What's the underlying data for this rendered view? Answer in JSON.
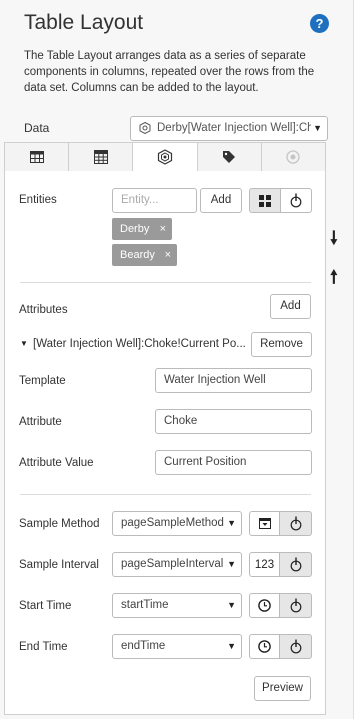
{
  "header": {
    "title": "Table Layout",
    "help_icon": "question-circle-icon",
    "description": "The Table Layout arranges data as a series of separate components in columns, repeated over the rows from the data set. Columns can be added to the layout."
  },
  "data": {
    "label": "Data",
    "selected": "Derby[Water Injection Well]:Cho"
  },
  "tabs": [
    {
      "icon": "table-icon",
      "active": false
    },
    {
      "icon": "calculator-icon",
      "active": false
    },
    {
      "icon": "hexagon-icon",
      "active": true
    },
    {
      "icon": "tag-icon",
      "active": false
    },
    {
      "icon": "circle-icon",
      "active": false
    }
  ],
  "entities": {
    "label": "Entities",
    "placeholder": "Entity...",
    "add_label": "Add",
    "chips": [
      {
        "label": "Derby",
        "remove": "×"
      },
      {
        "label": "Beardy",
        "remove": "×"
      }
    ]
  },
  "attributes": {
    "label": "Attributes",
    "add_label": "Add",
    "item_label": "[Water Injection Well]:Choke!Current Po...",
    "remove_label": "Remove",
    "template_label": "Template",
    "template_value": "Water Injection Well",
    "attribute_label": "Attribute",
    "attribute_value": "Choke",
    "attr_value_label": "Attribute Value",
    "attr_value_value": "Current Position"
  },
  "sampling": {
    "method_label": "Sample Method",
    "method_value": "pageSampleMethod",
    "interval_label": "Sample Interval",
    "interval_value": "pageSampleInterval",
    "interval_badge": "123",
    "start_label": "Start Time",
    "start_value": "startTime",
    "end_label": "End Time",
    "end_value": "endTime"
  },
  "footer": {
    "preview_label": "Preview"
  },
  "side": {
    "down_arrow": "🠗",
    "up_arrow": "🠕"
  },
  "colors": {
    "accent": "#1f6fbf",
    "chip": "#9a9a9a"
  }
}
